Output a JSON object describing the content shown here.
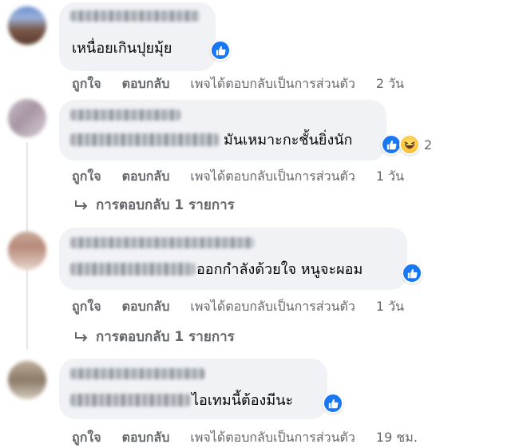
{
  "actions": {
    "like": "ถูกใจ",
    "reply": "ตอบกลับ",
    "page_reply_note": "เพจได้ตอบกลับเป็นการส่วนตัว"
  },
  "comments": [
    {
      "text": "เหนื่อยเกินปุยมุ้ย",
      "time": "2 วัน",
      "reactions": [
        "like-icon"
      ]
    },
    {
      "text": "มันเหมาะกะชั้นยิ่งนัก",
      "time": "1 วัน",
      "reactions": [
        "like-icon",
        "haha-icon"
      ],
      "reaction_count": "2",
      "replies_label": "การตอบกลับ 1 รายการ"
    },
    {
      "text": "ออกกำลังด้วยใจ หนูจะผอม",
      "time": "1 วัน",
      "reactions": [
        "like-icon"
      ],
      "replies_label": "การตอบกลับ 1 รายการ"
    },
    {
      "text": "ไอเทมนี้ต้องมีนะ",
      "time": "19 ชม.",
      "reactions": [
        "like-icon"
      ]
    }
  ],
  "colors": {
    "bubble": "#f0f2f5",
    "meta_text": "#65676b",
    "like_blue": "#1877f2"
  }
}
